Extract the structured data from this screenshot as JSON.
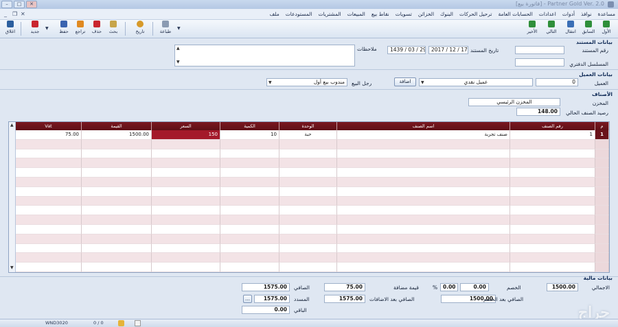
{
  "window": {
    "title": "Partner Gold Ver. 2.0 - [فاتورة بيع]"
  },
  "menu": [
    "ملف",
    "المستودعات",
    "المشتريات",
    "المبيعات",
    "نقاط بيع",
    "تسويات",
    "الخزائن",
    "البنوك",
    "ترحيل الحركات",
    "الحسابات العامة",
    "اعدادات",
    "أدوات",
    "نوافذ",
    "مساعدة"
  ],
  "toolbar": {
    "first": "الأول",
    "prev": "السابق",
    "jump": "انتقال",
    "next": "التالي",
    "last": "الأخير",
    "print": "طباعة",
    "history": "تاريخ",
    "search": "بحث",
    "delete": "حذف",
    "undo": "تراجع",
    "save": "حفظ",
    "new": "جديد",
    "close": "اغلاق"
  },
  "doc": {
    "section_title": "بيانات المستند",
    "doc_no_label": "رقم المستند",
    "doc_no_value": "",
    "doc_date_label": "تاريخ المستند",
    "doc_date_g": "2017 / 12 / 17",
    "doc_date_h": "1439 / 03 / 29",
    "notes_label": "ملاحظات",
    "notes_value": "",
    "ledger_label": "المسلسل الدفتري",
    "ledger_value": ""
  },
  "customer": {
    "section_title": "بيانات العميل",
    "label": "العميل",
    "code": "0",
    "name": "عميل نقدي",
    "add_button": "اضافة",
    "salesman_label": "رجل البيع",
    "salesman_value": "مندوب بيع أول"
  },
  "items": {
    "section_title": "الأصناف",
    "store_label": "المخزن",
    "store_value": "المخزن الرئيسي",
    "balance_label": "رصيد الصنف الحالي",
    "balance_value": "148.00"
  },
  "grid": {
    "columns": [
      "م",
      "رقم الصنف",
      "اسم الصنف",
      "الوحدة",
      "الكمية",
      "السعر",
      "القيمة",
      "Vat"
    ],
    "rows": [
      {
        "no": "1",
        "item_code": "1",
        "item_name": "صنف تجربة",
        "unit": "حبة",
        "qty": "10",
        "price": "150",
        "value": "1500.00",
        "vat": "75.00"
      }
    ]
  },
  "totals": {
    "section_title": "بيانات مالية",
    "total_label": "الاجمالي",
    "total_value": "1500.00",
    "discount_label": "الخصم",
    "discount_value": "0.00",
    "discount_pct": "0.00",
    "pct_sign": "%",
    "added_value_label": "قيمة مضافة",
    "added_value": "75.00",
    "net_label": "الصافي",
    "net_value": "1575.00",
    "net_after_discount_label": "الصافي بعد الخصم",
    "net_after_discount_value": "1500.00",
    "net_after_additions_label": "الصافي بعد الاضافات",
    "net_after_additions_value": "1575.00",
    "paid_label": "المسدد",
    "paid_value": "1575.00",
    "remaining_label": "الباقي",
    "remaining_value": "0.00"
  },
  "status": {
    "machine": "WND3020",
    "counter": "0 / 0"
  },
  "watermark": "حراج"
}
